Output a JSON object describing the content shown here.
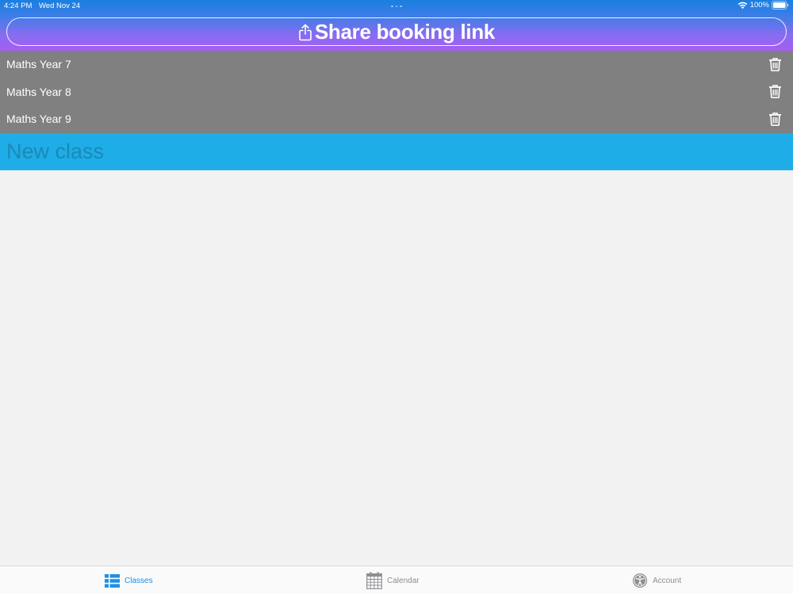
{
  "status_bar": {
    "time": "4:24 PM",
    "date": "Wed Nov 24",
    "battery": "100%"
  },
  "share": {
    "label": "Share booking link",
    "icon": "share-icon"
  },
  "classes": [
    {
      "name": "Maths Year 7",
      "icon": "trash-icon"
    },
    {
      "name": "Maths Year 8",
      "icon": "trash-icon"
    },
    {
      "name": "Maths Year 9",
      "icon": "trash-icon"
    }
  ],
  "new_class": {
    "placeholder": "New class",
    "value": ""
  },
  "tabs": [
    {
      "label": "Classes",
      "icon": "list-icon",
      "active": true
    },
    {
      "label": "Calendar",
      "icon": "calendar-icon",
      "active": false
    },
    {
      "label": "Account",
      "icon": "accessibility-icon",
      "active": false
    }
  ],
  "colors": {
    "header_top": "#1a7fe0",
    "header_bottom": "#a45ef4",
    "list_bg": "#808080",
    "input_bg": "#1eade6",
    "tab_active": "#1d8fe6",
    "tab_inactive": "#8e8e93",
    "page_bg": "#f2f2f2"
  }
}
